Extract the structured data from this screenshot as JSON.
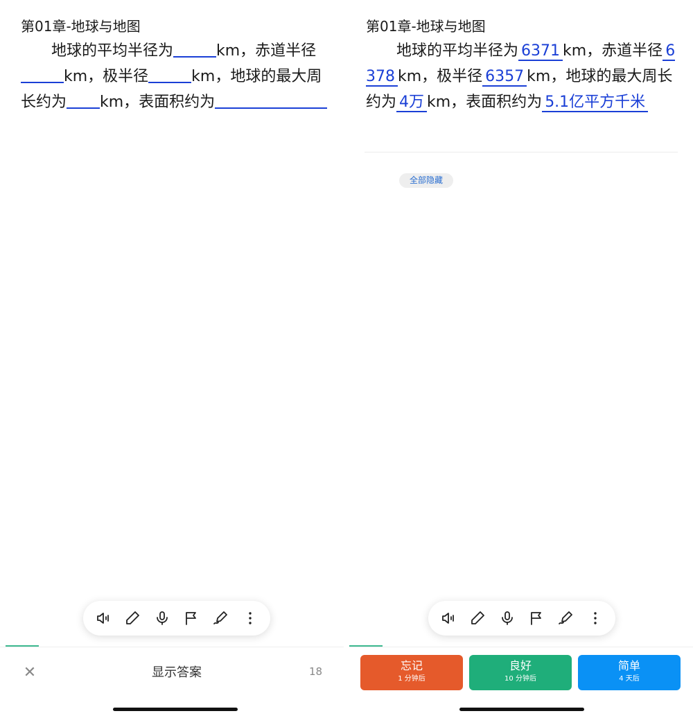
{
  "card": {
    "title": "第01章-地球与地图",
    "segments": {
      "s1": "地球的平均半径为",
      "s2": "km，赤道半径",
      "s3": "km，极半径",
      "s4": "km，地球的最大周长约为",
      "s5": "km，表面积约为"
    },
    "answers": {
      "a1": "6371",
      "a2": "6378",
      "a3": "6357",
      "a4": "4万",
      "a5": "5.1亿平方千米"
    }
  },
  "answer_view": {
    "hide_all_label": "全部隐藏"
  },
  "toolbar": {
    "icons": [
      "speaker-icon",
      "pencil-icon",
      "microphone-icon",
      "flag-icon",
      "draw-icon",
      "more-icon"
    ]
  },
  "question_footer": {
    "close_icon": "✕",
    "show_answer_label": "显示答案",
    "count": "18"
  },
  "rating": {
    "again": {
      "label": "忘记",
      "interval": "1 分钟后",
      "color": "#e55a2b"
    },
    "good": {
      "label": "良好",
      "interval": "10 分钟后",
      "color": "#1fae7a"
    },
    "easy": {
      "label": "简单",
      "interval": "4 天后",
      "color": "#0a91f5"
    }
  },
  "colors": {
    "accent_blue": "#1a3fd6",
    "progress_green": "#3cb88f"
  }
}
